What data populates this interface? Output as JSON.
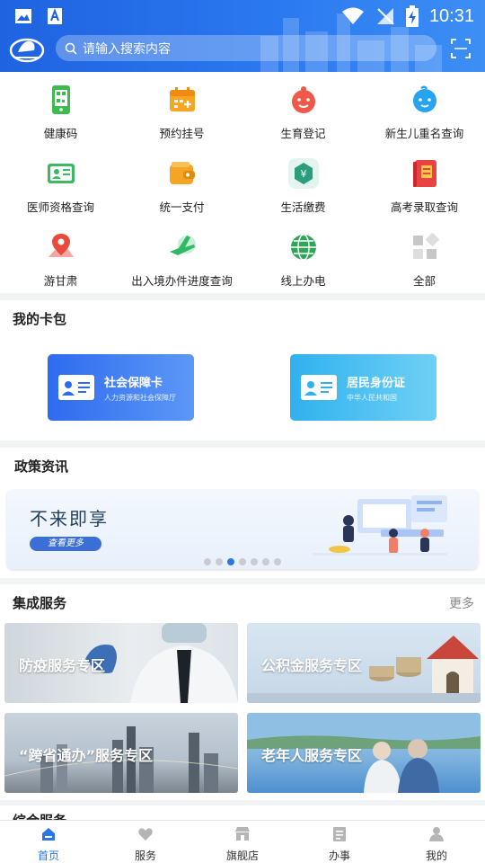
{
  "status_bar": {
    "time": "10:31"
  },
  "header": {
    "search_placeholder": "请输入搜索内容"
  },
  "quick_services": [
    {
      "label": "健康码",
      "icon": "phone-qr-icon"
    },
    {
      "label": "预约挂号",
      "icon": "calendar-plus-icon"
    },
    {
      "label": "生育登记",
      "icon": "baby-face-icon"
    },
    {
      "label": "新生儿重名查询",
      "icon": "baby-name-icon"
    },
    {
      "label": "医师资格查询",
      "icon": "doctor-license-icon"
    },
    {
      "label": "统一支付",
      "icon": "wallet-icon"
    },
    {
      "label": "生活缴费",
      "icon": "yuan-payment-icon"
    },
    {
      "label": "高考录取查询",
      "icon": "admission-book-icon"
    },
    {
      "label": "游甘肃",
      "icon": "location-pin-icon"
    },
    {
      "label": "出入境办件进度查询",
      "icon": "airplane-icon"
    },
    {
      "label": "线上办电",
      "icon": "globe-power-icon"
    },
    {
      "label": "全部",
      "icon": "all-grid-icon"
    }
  ],
  "card_pack": {
    "title": "我的卡包",
    "cards": [
      {
        "title": "社会保障卡",
        "subtitle": "人力资源和社会保障厅",
        "color": "#2f6ff0"
      },
      {
        "title": "居民身份证",
        "subtitle": "中华人民共和国",
        "color": "#3cb9ef"
      }
    ]
  },
  "policy": {
    "title": "政策资讯",
    "banner_slogan": "不来即享",
    "banner_button": "查看更多",
    "carousel_count": 7,
    "carousel_active": 3
  },
  "integrated": {
    "title": "集成服务",
    "more": "更多",
    "tiles": [
      {
        "label": "防疫服务专区"
      },
      {
        "label": "公积金服务专区"
      },
      {
        "label": "“跨省通办”服务专区"
      },
      {
        "label": "老年人服务专区"
      }
    ]
  },
  "next_section": {
    "title": "综合服务"
  },
  "bottom_nav": [
    {
      "label": "首页",
      "icon": "home-icon",
      "active": true
    },
    {
      "label": "服务",
      "icon": "heart-service-icon",
      "active": false
    },
    {
      "label": "旗舰店",
      "icon": "store-icon",
      "active": false
    },
    {
      "label": "办事",
      "icon": "document-icon",
      "active": false
    },
    {
      "label": "我的",
      "icon": "user-icon",
      "active": false
    }
  ],
  "colors": {
    "primary": "#2a76e6",
    "header_start": "#1f63e0",
    "header_end": "#3d8ef5"
  }
}
